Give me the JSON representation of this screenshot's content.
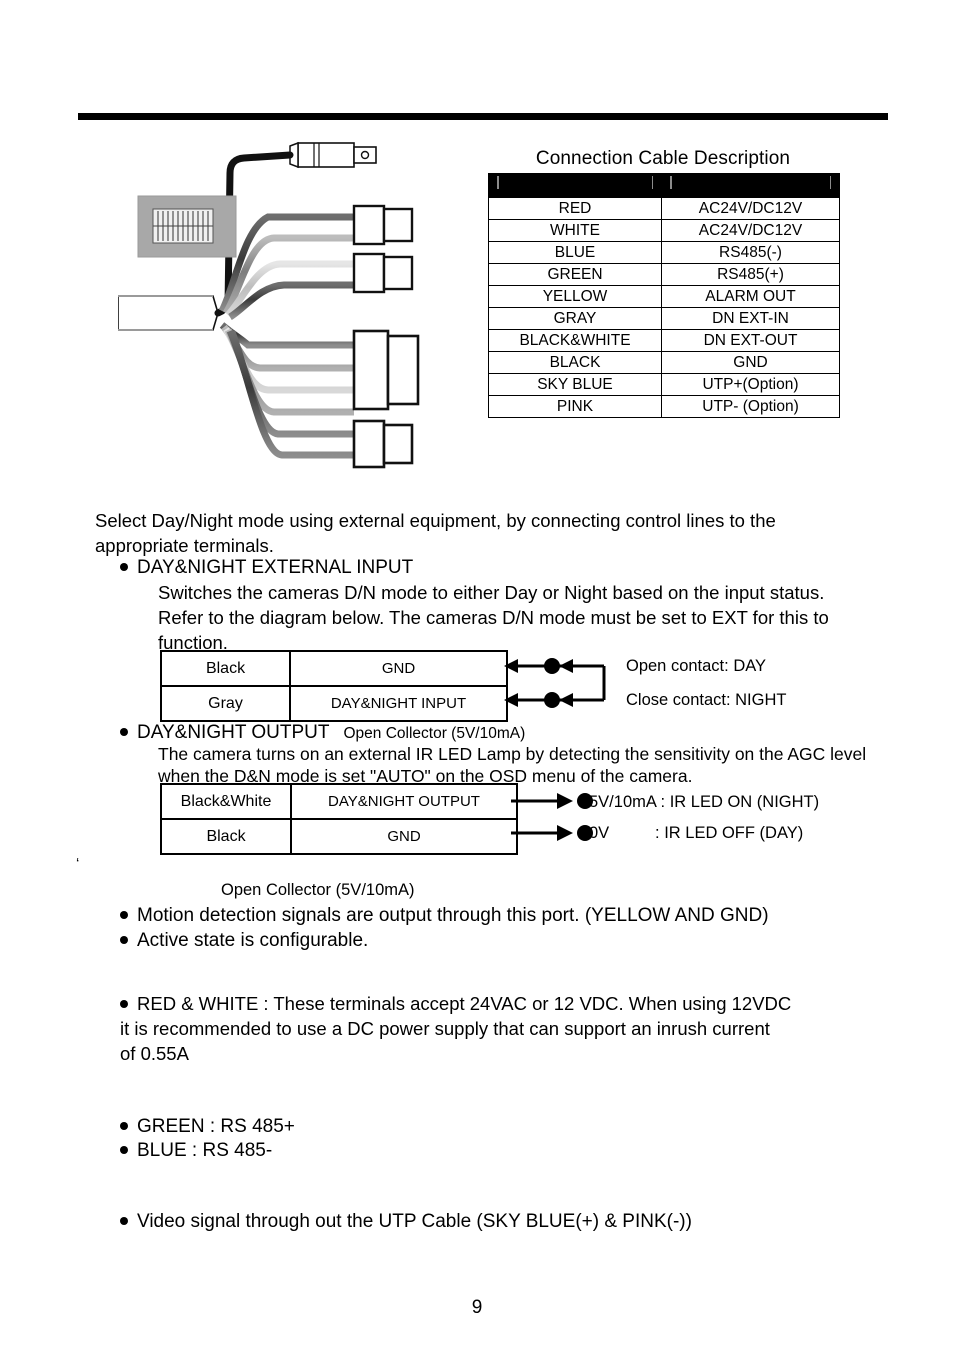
{
  "page_number": "9",
  "cable_table": {
    "title": "Connection Cable Description",
    "headers": [
      "",
      ""
    ],
    "rows": [
      [
        "RED",
        "AC24V/DC12V"
      ],
      [
        "WHITE",
        "AC24V/DC12V"
      ],
      [
        "BLUE",
        "RS485(-)"
      ],
      [
        "GREEN",
        "RS485(+)"
      ],
      [
        "YELLOW",
        "ALARM OUT"
      ],
      [
        "GRAY",
        "DN EXT-IN"
      ],
      [
        "BLACK&WHITE",
        "DN EXT-OUT"
      ],
      [
        "BLACK",
        "GND"
      ],
      [
        "SKY BLUE",
        "UTP+(Option)"
      ],
      [
        "PINK",
        "UTP- (Option)"
      ]
    ]
  },
  "intro_text": "Select Day/Night mode using external equipment, by connecting control lines to the appropriate terminals.",
  "day_night_input": {
    "heading": "DAY&NIGHT EXTERNAL INPUT",
    "description": "Switches the cameras D/N mode to either Day or Night based on the input status. Refer to the diagram below. The cameras D/N mode must be set to EXT for this to function.",
    "table_rows": [
      [
        "Black",
        "GND"
      ],
      [
        "Gray",
        "DAY&NIGHT INPUT"
      ]
    ],
    "contact_labels": [
      "Open contact: DAY",
      "Close contact: NIGHT"
    ]
  },
  "day_night_output": {
    "heading": "DAY&NIGHT OUTPUT",
    "heading_note": "Open Collector (5V/10mA)",
    "description": "The camera turns on an external IR LED Lamp by detecting the sensitivity on the AGC level when the D&N mode is set \"AUTO\" on the OSD menu of the camera.",
    "table_rows": [
      [
        "Black&White",
        "DAY&NIGHT OUTPUT"
      ],
      [
        "Black",
        "GND"
      ]
    ],
    "signal_labels": [
      "5V/10mA : IR LED ON (NIGHT)",
      "0V          : IR LED OFF (DAY)"
    ]
  },
  "alarm_section": {
    "open_collector_note": "Open Collector (5V/10mA)",
    "stray_mark": "‘",
    "bullets": [
      "Motion detection signals are output through this port.  (YELLOW AND GND)",
      "Active state is configurable."
    ]
  },
  "power_section": {
    "line1": "RED & WHITE : These terminals accept 24VAC or 12 VDC. When using 12VDC",
    "line2": "it is recommended to use a DC power supply that can support an inrush current",
    "line3": "of 0.55A"
  },
  "rs485_section": {
    "green": "GREEN : RS 485+",
    "blue": "BLUE : RS 485-"
  },
  "utp_section": {
    "video": "Video signal through out the UTP Cable (SKY BLUE(+) & PINK(-))"
  },
  "colors": {
    "ink": "#000000",
    "paper": "#ffffff",
    "figure_gray": "#9a9a9a",
    "figure_light": "#d0d0d0"
  }
}
